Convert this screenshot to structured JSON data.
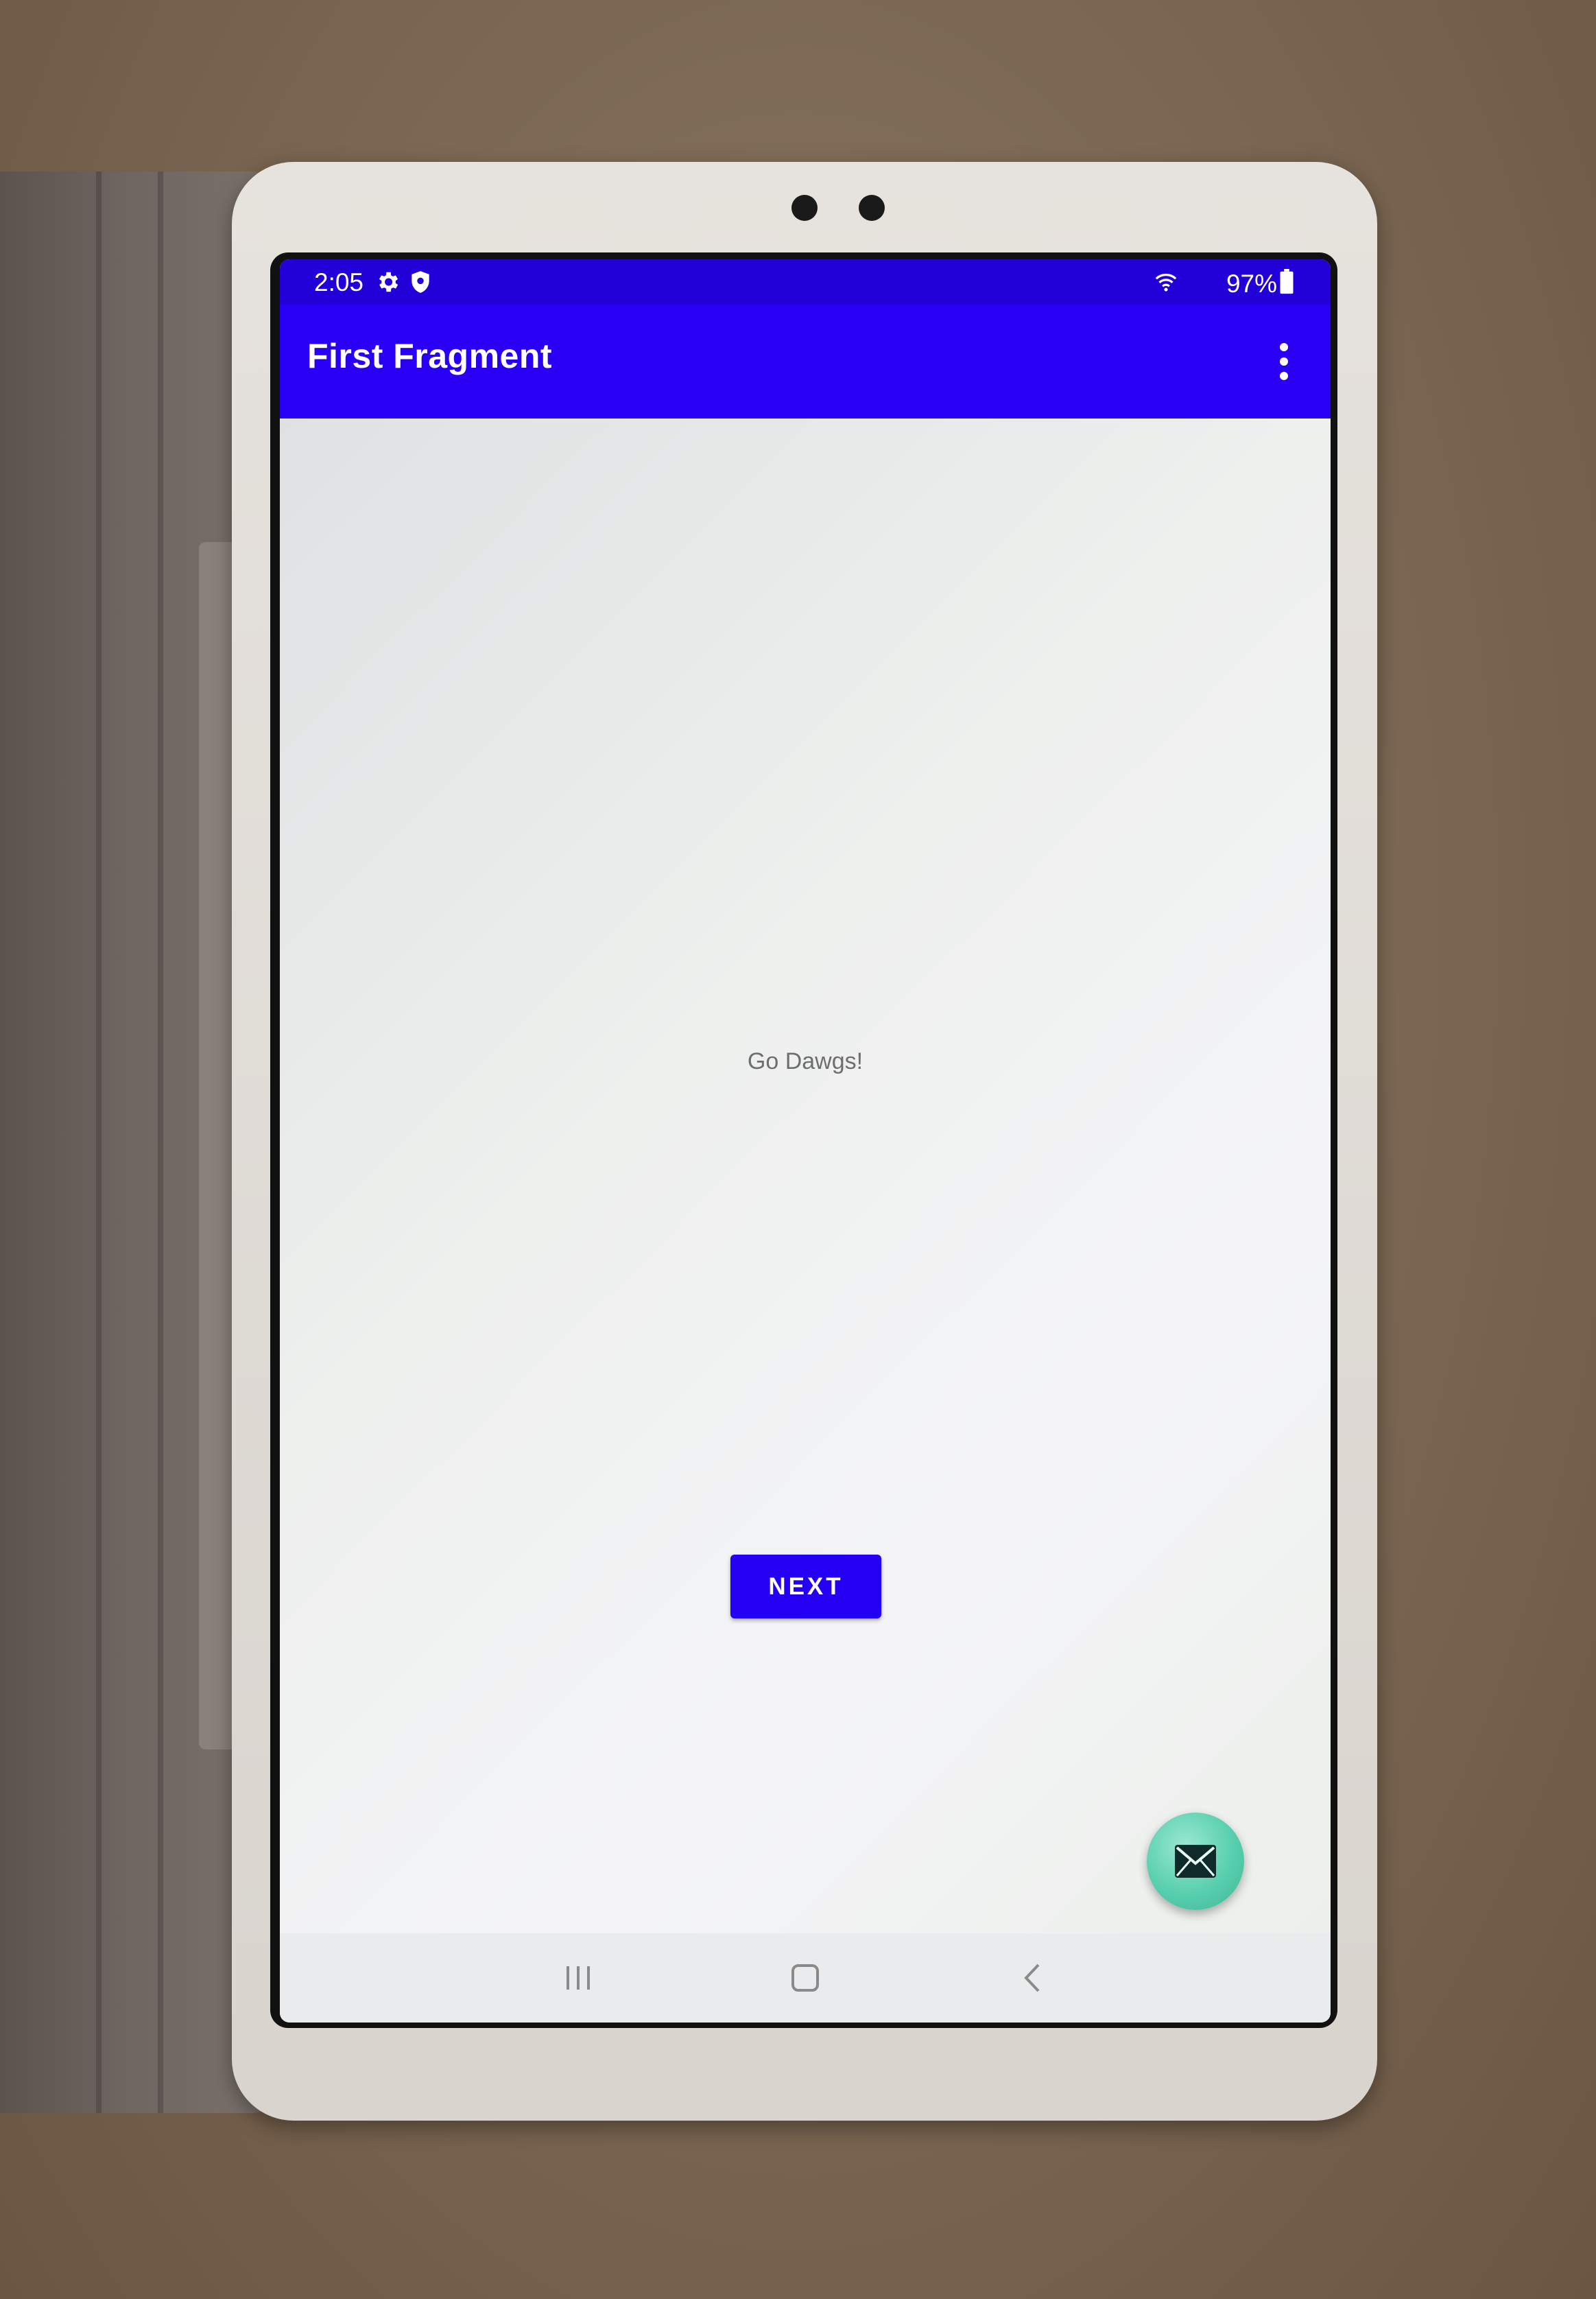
{
  "status_bar": {
    "time": "2:05",
    "battery": "97%",
    "icons": [
      "settings-icon",
      "shield-icon",
      "wifi-icon",
      "battery-icon"
    ]
  },
  "app_bar": {
    "title": "First Fragment",
    "menu_icon": "overflow-menu-icon"
  },
  "content": {
    "message": "Go Dawgs!",
    "next_button_label": "NEXT"
  },
  "fab": {
    "icon": "email-icon"
  },
  "nav_bar": {
    "buttons": [
      "recents-icon",
      "home-icon",
      "back-icon"
    ]
  },
  "colors": {
    "primary": "#2a00f5",
    "primary_dark": "#2200d8",
    "accent": "#58cfae"
  }
}
